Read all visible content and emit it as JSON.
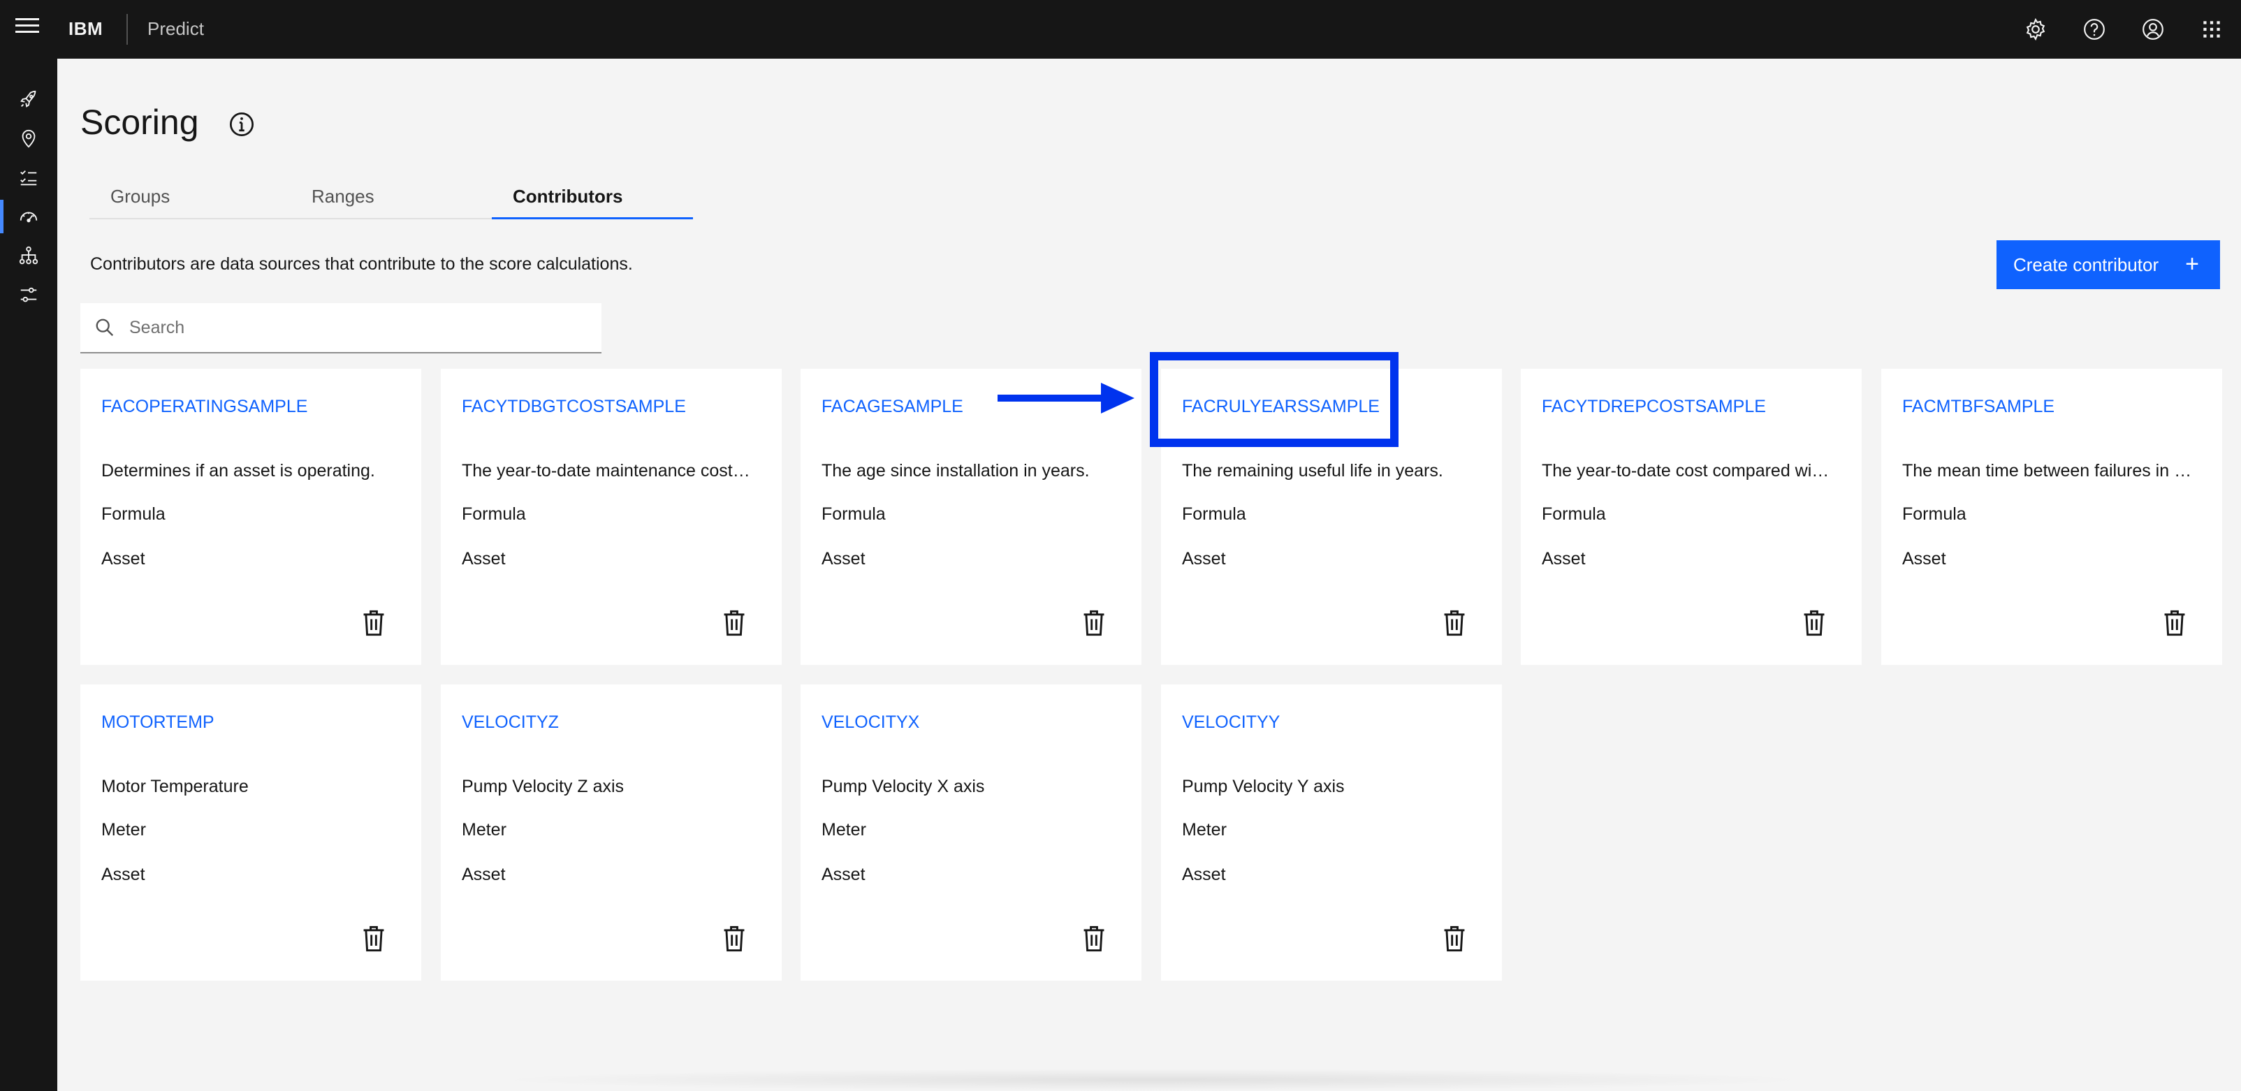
{
  "header": {
    "brand": "IBM",
    "product": "Predict",
    "icons": [
      "settings-icon",
      "help-icon",
      "user-icon",
      "app-switcher-icon"
    ]
  },
  "sidenav": {
    "items": [
      "rocket-icon",
      "location-icon",
      "checklist-icon",
      "dashboard-gauge-icon",
      "hierarchy-icon",
      "settings-adjust-icon"
    ],
    "active_index": 3
  },
  "page": {
    "title": "Scoring",
    "tabs": [
      {
        "label": "Groups",
        "selected": false
      },
      {
        "label": "Ranges",
        "selected": false
      },
      {
        "label": "Contributors",
        "selected": true
      }
    ],
    "description": "Contributors are data sources that contribute to the score calculations.",
    "create_button": "Create contributor",
    "search_placeholder": "Search"
  },
  "cards": [
    {
      "title": "FACOPERATINGSAMPLE",
      "description": "Determines if an asset is operating.",
      "type": "Formula",
      "scope": "Asset"
    },
    {
      "title": "FACYTDBGTCOSTSAMPLE",
      "description": "The year-to-date maintenance cost…",
      "type": "Formula",
      "scope": "Asset"
    },
    {
      "title": "FACAGESAMPLE",
      "description": "The age since installation in years.",
      "type": "Formula",
      "scope": "Asset"
    },
    {
      "title": "FACRULYEARSSAMPLE",
      "description": "The remaining useful life in years.",
      "type": "Formula",
      "scope": "Asset"
    },
    {
      "title": "FACYTDREPCOSTSAMPLE",
      "description": "The year-to-date cost compared wi…",
      "type": "Formula",
      "scope": "Asset"
    },
    {
      "title": "FACMTBFSAMPLE",
      "description": "The mean time between failures in …",
      "type": "Formula",
      "scope": "Asset"
    },
    {
      "title": "MOTORTEMP",
      "description": "Motor Temperature",
      "type": "Meter",
      "scope": "Asset"
    },
    {
      "title": "VELOCITYZ",
      "description": "Pump Velocity Z axis",
      "type": "Meter",
      "scope": "Asset"
    },
    {
      "title": "VELOCITYX",
      "description": "Pump Velocity X axis",
      "type": "Meter",
      "scope": "Asset"
    },
    {
      "title": "VELOCITYY",
      "description": "Pump Velocity Y axis",
      "type": "Meter",
      "scope": "Asset"
    }
  ],
  "annotation": {
    "highlight_color": "#0033ee",
    "highlighted_card": "FACRULYEARSSAMPLE"
  },
  "colors": {
    "accent": "#0f62fe",
    "header_bg": "#161616",
    "page_bg": "#f4f4f4"
  }
}
